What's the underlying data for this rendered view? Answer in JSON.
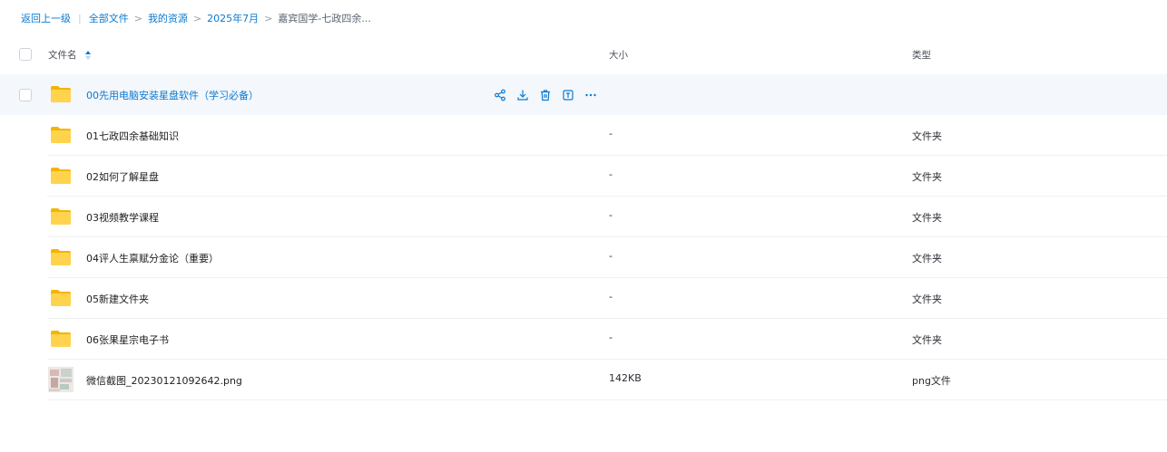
{
  "breadcrumb": {
    "back": "返回上一级",
    "items": [
      "全部文件",
      "我的资源",
      "2025年7月"
    ],
    "current": "嘉宾国学-七政四余..."
  },
  "table": {
    "headers": {
      "name": "文件名",
      "size": "大小",
      "type": "类型"
    },
    "rows": [
      {
        "name": "00先用电脑安装星盘软件（学习必备）",
        "size": "",
        "type": "",
        "icon": "folder-icon"
      },
      {
        "name": "01七政四余基础知识",
        "size": "-",
        "type": "文件夹",
        "icon": "folder-icon"
      },
      {
        "name": "02如何了解星盘",
        "size": "-",
        "type": "文件夹",
        "icon": "folder-icon"
      },
      {
        "name": "03视频教学课程",
        "size": "-",
        "type": "文件夹",
        "icon": "folder-icon"
      },
      {
        "name": "04评人生禀赋分金论（重要）",
        "size": "-",
        "type": "文件夹",
        "icon": "folder-icon"
      },
      {
        "name": "05新建文件夹",
        "size": "-",
        "type": "文件夹",
        "icon": "folder-icon"
      },
      {
        "name": "06张果星宗电子书",
        "size": "-",
        "type": "文件夹",
        "icon": "folder-icon"
      },
      {
        "name": "微信截图_20230121092642.png",
        "size": "142KB",
        "type": "png文件",
        "icon": "image-thumbnail-icon"
      }
    ],
    "hover_actions": [
      "share-icon",
      "download-icon",
      "delete-icon",
      "rename-icon",
      "more-icon"
    ]
  },
  "colors": {
    "accent": "#0b7ad1",
    "folder": "#ffc93d",
    "hover_row": "#f4f7fb"
  }
}
